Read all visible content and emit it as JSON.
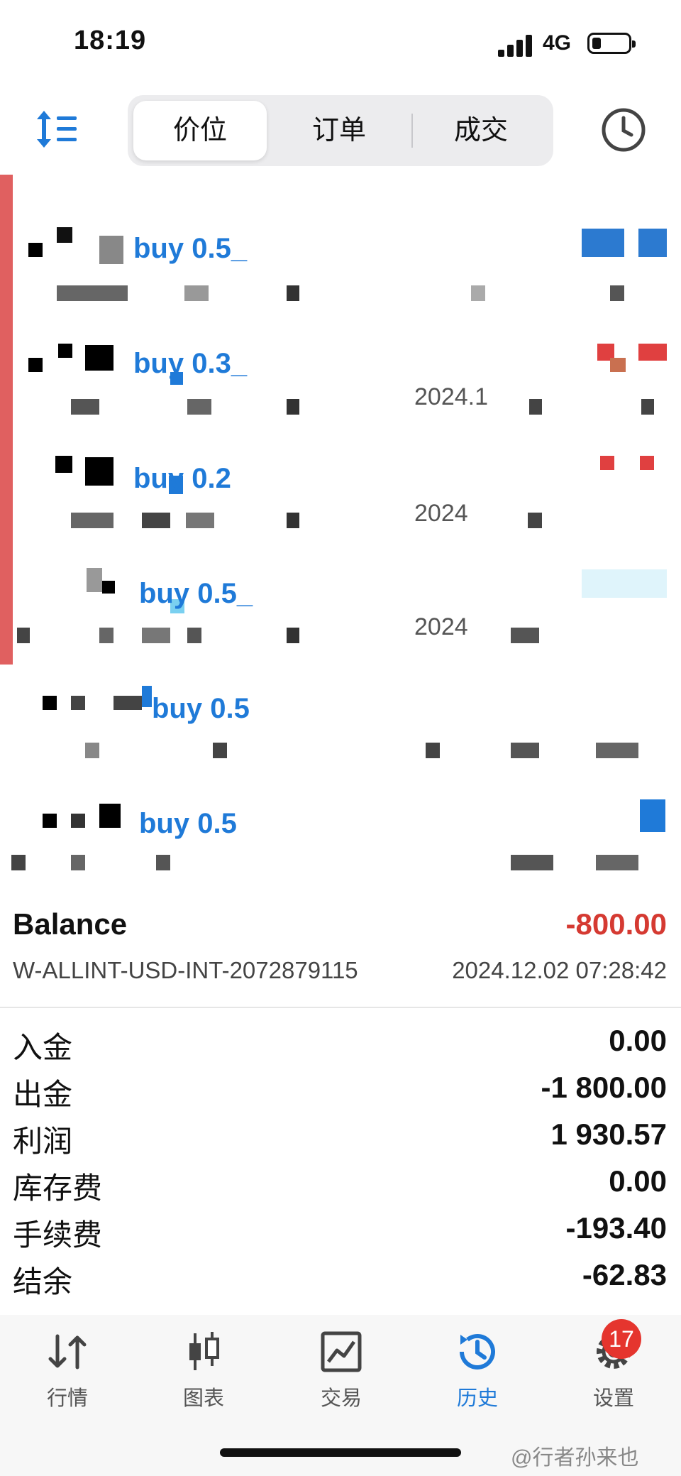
{
  "status_bar": {
    "time": "18:19",
    "network": "4G"
  },
  "segment": {
    "tabs": [
      "价位",
      "订单",
      "成交"
    ],
    "active_index": 0
  },
  "trades": [
    {
      "label": "buy 0.5_",
      "date": ""
    },
    {
      "label": "buy 0.3_",
      "date": "2024.1"
    },
    {
      "label": "buy 0.2",
      "date": "2024"
    },
    {
      "label": "buy 0.5_",
      "date": "2024"
    },
    {
      "label": "buy 0.5",
      "date": ""
    },
    {
      "label": "buy 0.5",
      "date": ""
    }
  ],
  "balance": {
    "label": "Balance",
    "value": "-800.00",
    "account": "W-ALLINT-USD-INT-2072879115",
    "datetime": "2024.12.02 07:28:42"
  },
  "summary": [
    {
      "label": "入金",
      "value": "0.00"
    },
    {
      "label": "出金",
      "value": "-1 800.00"
    },
    {
      "label": "利润",
      "value": "1 930.57"
    },
    {
      "label": "库存费",
      "value": "0.00"
    },
    {
      "label": "手续费",
      "value": "-193.40"
    },
    {
      "label": "结余",
      "value": "-62.83"
    }
  ],
  "tabbar": {
    "items": [
      {
        "label": "行情",
        "icon": "quotes-arrows-icon"
      },
      {
        "label": "图表",
        "icon": "candlestick-chart-icon"
      },
      {
        "label": "交易",
        "icon": "trade-chart-icon"
      },
      {
        "label": "历史",
        "icon": "history-clock-icon"
      },
      {
        "label": "设置",
        "icon": "settings-gear-icon"
      }
    ],
    "active_index": 3,
    "settings_badge": "17"
  },
  "watermark": "@行者孙来也",
  "colors": {
    "accent": "#1f7ad8",
    "negative": "#d53a32",
    "redact_bar": "#e06060"
  }
}
